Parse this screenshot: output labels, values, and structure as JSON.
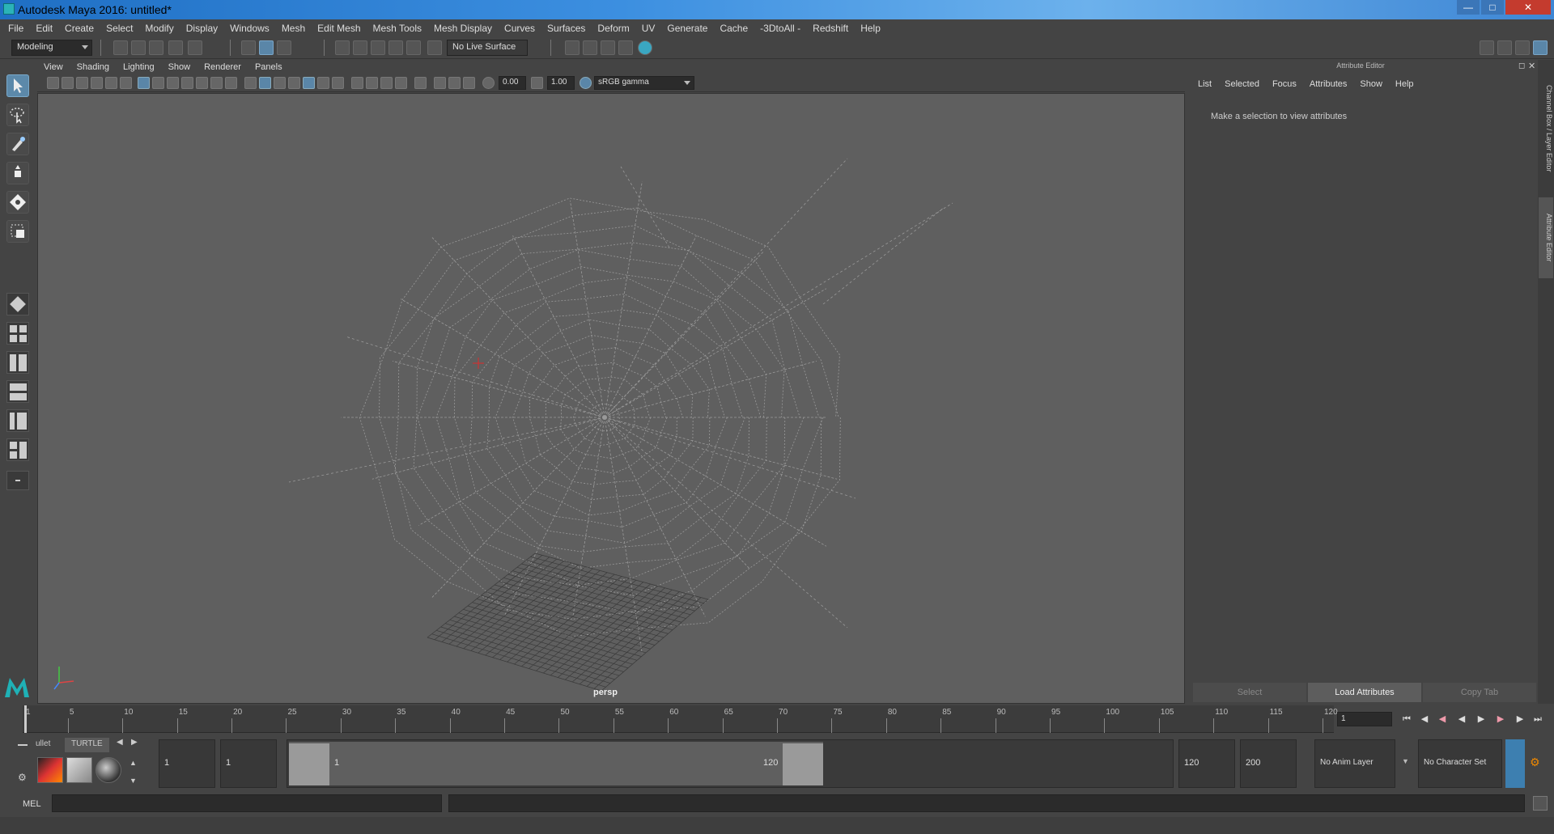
{
  "window": {
    "title": "Autodesk Maya 2016: untitled*"
  },
  "menubar": [
    "File",
    "Edit",
    "Create",
    "Select",
    "Modify",
    "Display",
    "Windows",
    "Mesh",
    "Edit Mesh",
    "Mesh Tools",
    "Mesh Display",
    "Curves",
    "Surfaces",
    "Deform",
    "UV",
    "Generate",
    "Cache",
    "-3DtoAll -",
    "Redshift",
    "Help"
  ],
  "statusline": {
    "menu_set": "Modeling",
    "live_surface": "No Live Surface"
  },
  "viewport": {
    "menu": [
      "View",
      "Shading",
      "Lighting",
      "Show",
      "Renderer",
      "Panels"
    ],
    "exposure": "0.00",
    "gamma": "1.00",
    "color_space": "sRGB gamma",
    "camera": "persp"
  },
  "attribute_editor": {
    "title": "Attribute Editor",
    "menu": [
      "List",
      "Selected",
      "Focus",
      "Attributes",
      "Show",
      "Help"
    ],
    "message": "Make a selection to view attributes",
    "buttons": {
      "select": "Select",
      "load": "Load Attributes",
      "copy": "Copy Tab"
    },
    "side_tabs": {
      "channel_box": "Channel Box / Layer Editor",
      "attribute_editor": "Attribute Editor"
    }
  },
  "timeslider": {
    "ticks": [
      "1",
      "5",
      "10",
      "15",
      "20",
      "25",
      "30",
      "35",
      "40",
      "45",
      "50",
      "55",
      "60",
      "65",
      "70",
      "75",
      "80",
      "85",
      "90",
      "95",
      "100",
      "105",
      "110",
      "115",
      "120"
    ],
    "current_frame": "1"
  },
  "range": {
    "shelf_tabs": [
      "ullet",
      "TURTLE"
    ],
    "start": "1",
    "playback_start": "1",
    "range_start_label": "1",
    "range_end_label": "120",
    "playback_end": "120",
    "end": "200",
    "anim_layer": "No Anim Layer",
    "character_set": "No Character Set"
  },
  "cmdline": {
    "label": "MEL"
  }
}
